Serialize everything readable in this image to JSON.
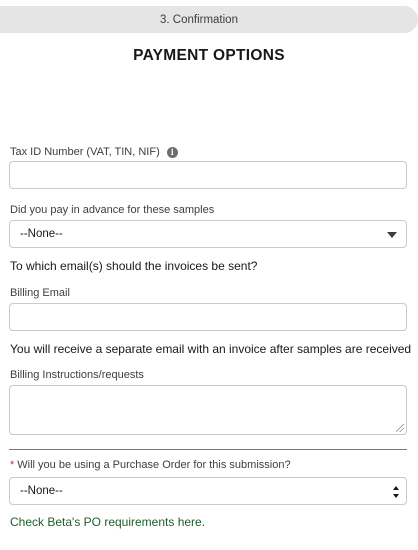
{
  "step": {
    "label": "3. Confirmation"
  },
  "page": {
    "title": "PAYMENT OPTIONS"
  },
  "tax_id": {
    "label": "Tax ID Number (VAT, TIN, NIF)",
    "value": ""
  },
  "paid_advance": {
    "label": "Did you pay in advance for these samples",
    "selected": "--None--"
  },
  "invoice_question": "To which email(s) should the invoices be sent?",
  "billing_email": {
    "label": "Billing Email",
    "value": ""
  },
  "invoice_notice": "You will receive a separate email with an invoice after samples are received",
  "billing_instructions": {
    "label": "Billing Instructions/requests",
    "value": ""
  },
  "purchase_order": {
    "required_marker": "*",
    "label": "Will you be using a Purchase Order for this submission?",
    "selected": "--None--"
  },
  "po_link": "Check Beta's PO requirements here.",
  "colors": {
    "link": "#1f5d2b",
    "required": "#c23934",
    "pill_bg": "#e5e5e5"
  }
}
